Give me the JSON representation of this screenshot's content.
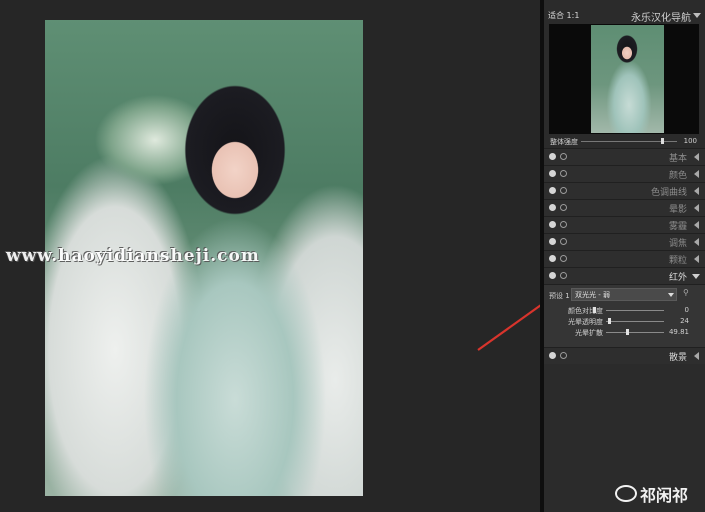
{
  "watermark": "www.haoyidiansheji.com",
  "navigator": {
    "left_label": "适合  1:1",
    "title": "永乐汉化导航"
  },
  "overall_strength": {
    "label": "整体强度",
    "value": "100",
    "fraction": 0.84
  },
  "sections_top": [
    {
      "name": "基本"
    },
    {
      "name": "颜色"
    },
    {
      "name": "色调曲线"
    },
    {
      "name": "晕影"
    },
    {
      "name": "雾霾"
    },
    {
      "name": "调焦"
    },
    {
      "name": "颗粒"
    }
  ],
  "expanded_section": {
    "name": "红外",
    "preset_label": "预设 1",
    "preset_value": "双光光 - 弱",
    "params": [
      {
        "label": "颜色对比度",
        "value": "0",
        "fraction": 0.0
      },
      {
        "label": "光晕透明度",
        "value": "24",
        "fraction": 0.24
      },
      {
        "label": "光晕扩散",
        "value": "49.81",
        "fraction": 0.5
      }
    ]
  },
  "section_bottom": {
    "name": "散景"
  },
  "weibo_logo": "祁闲祁",
  "colors": {
    "arrow": "#d8342c",
    "panel_bg": "#2b2b2b"
  }
}
